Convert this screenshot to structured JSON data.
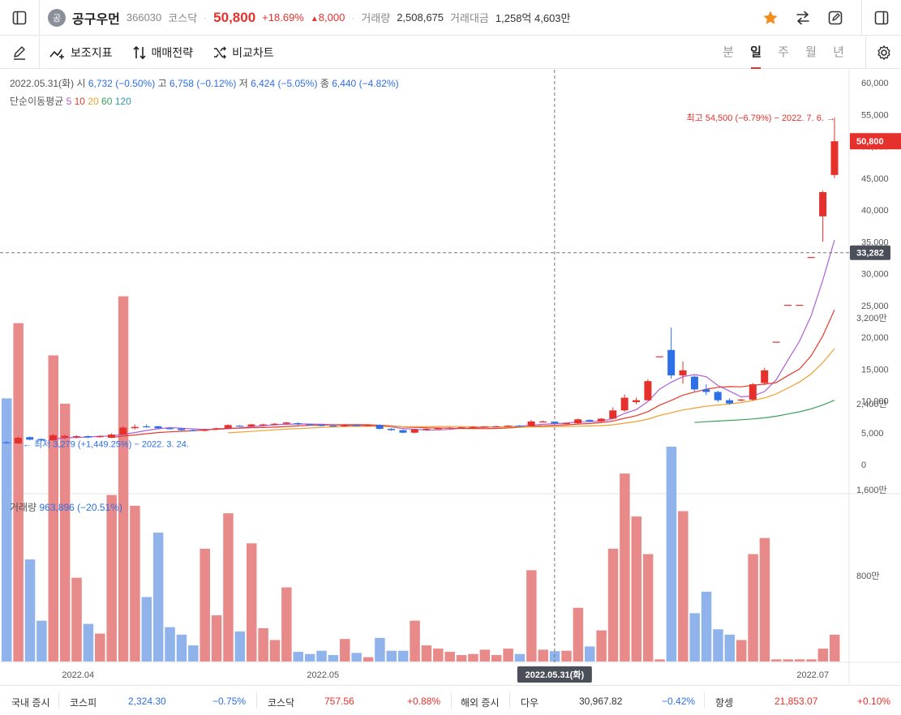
{
  "header": {
    "badge": "공",
    "name": "공구우먼",
    "code": "366030",
    "market": "코스닥",
    "price": "50,800",
    "change_pct": "+18.69%",
    "change_amt": "8,000",
    "volume_label": "거래량",
    "volume": "2,508,675",
    "amount_label": "거래대금",
    "amount": "1,258억 4,603만"
  },
  "toolbar": {
    "indicator_label": "보조지표",
    "strategy_label": "매매전략",
    "compare_label": "비교차트",
    "periods": [
      "분",
      "일",
      "주",
      "월",
      "년"
    ],
    "active_period": "일"
  },
  "ohlc_info": {
    "date": "2022.05.31(화)",
    "open_label": "시",
    "open": "6,732 (−0.50%)",
    "high_label": "고",
    "high": "6,758 (−0.12%)",
    "low_label": "저",
    "low": "6,424 (−5.05%)",
    "close_label": "종",
    "close": "6,440 (−4.82%)"
  },
  "ma_legend": {
    "label": "단순이동평균",
    "items": [
      {
        "name": "5",
        "color": "#b05fd6"
      },
      {
        "name": "10",
        "color": "#e63b2c"
      },
      {
        "name": "20",
        "color": "#f0a12c"
      },
      {
        "name": "60",
        "color": "#3aa05a"
      },
      {
        "name": "120",
        "color": "#2b9ab3"
      }
    ]
  },
  "volume_info": {
    "label": "거래량",
    "value": "963,896 (−20.51%)"
  },
  "footer": {
    "domestic_label": "국내 증시",
    "kospi_label": "코스피",
    "kospi": "2,324.30",
    "kospi_chg": "−0.75%",
    "kosdaq_label": "코스닥",
    "kosdaq": "757.56",
    "kosdaq_chg": "+0.88%",
    "overseas_label": "해외 증시",
    "dow_label": "다우",
    "dow": "30,967.82",
    "dow_chg": "−0.42%",
    "hs_label": "항셍",
    "hs": "21,853.07",
    "hs_chg": "+0.10%"
  },
  "colors": {
    "up": "#e6302c",
    "down": "#2d6fe6",
    "vol_up": "#e88a8a",
    "vol_down": "#8fb3ea",
    "star": "#f28c1c"
  },
  "chart_data": {
    "type": "candlestick",
    "price_axis": {
      "min": 0,
      "max": 60000,
      "ticks": [
        "60,000",
        "55,000",
        "50,000",
        "45,000",
        "40,000",
        "35,000",
        "30,000",
        "25,000",
        "20,000",
        "15,000",
        "10,000",
        "5,000",
        "0"
      ]
    },
    "volume_axis": {
      "max": 3600,
      "unit": "만",
      "ticks": [
        "3,200만",
        "2,400만",
        "1,600만",
        "800만"
      ]
    },
    "x_labels": [
      "2022.04",
      "2022.05",
      "2022.07"
    ],
    "crosshair": {
      "date": "2022.05.31(화)",
      "price": "33,282"
    },
    "current_price": "50,800",
    "annotation_high": "최고 54,500 (−6.79%) − 2022. 7. 6.",
    "annotation_low": "최저 3,279 (+1,449.25%) − 2022. 3. 24.",
    "candles": [
      {
        "date": "2022-03-24",
        "o": 3500,
        "h": 3650,
        "l": 3279,
        "c": 3400,
        "v": 2450
      },
      {
        "date": "2022-03-25",
        "o": 3300,
        "h": 4400,
        "l": 3250,
        "c": 4200,
        "v": 3150
      },
      {
        "date": "2022-03-28",
        "o": 4300,
        "h": 4400,
        "l": 3800,
        "c": 3900,
        "v": 950
      },
      {
        "date": "2022-03-29",
        "o": 4000,
        "h": 4100,
        "l": 3700,
        "c": 3800,
        "v": 380
      },
      {
        "date": "2022-03-30",
        "o": 3800,
        "h": 4800,
        "l": 3750,
        "c": 4600,
        "v": 2850
      },
      {
        "date": "2022-03-31",
        "o": 4200,
        "h": 4700,
        "l": 4000,
        "c": 4500,
        "v": 2400
      },
      {
        "date": "2022-04-01",
        "o": 4300,
        "h": 4600,
        "l": 4100,
        "c": 4450,
        "v": 780
      },
      {
        "date": "2022-04-04",
        "o": 4450,
        "h": 4550,
        "l": 4150,
        "c": 4250,
        "v": 350
      },
      {
        "date": "2022-04-05",
        "o": 4300,
        "h": 4550,
        "l": 4200,
        "c": 4450,
        "v": 260
      },
      {
        "date": "2022-04-06",
        "o": 4200,
        "h": 4900,
        "l": 4150,
        "c": 4700,
        "v": 1550
      },
      {
        "date": "2022-04-07",
        "o": 4700,
        "h": 6000,
        "l": 4650,
        "c": 5800,
        "v": 3400
      },
      {
        "date": "2022-04-08",
        "o": 5700,
        "h": 6300,
        "l": 5500,
        "c": 5900,
        "v": 1450
      },
      {
        "date": "2022-04-11",
        "o": 6000,
        "h": 6300,
        "l": 5800,
        "c": 5900,
        "v": 600
      },
      {
        "date": "2022-04-12",
        "o": 6000,
        "h": 6100,
        "l": 5600,
        "c": 5700,
        "v": 1200
      },
      {
        "date": "2022-04-13",
        "o": 5700,
        "h": 5800,
        "l": 5500,
        "c": 5650,
        "v": 320
      },
      {
        "date": "2022-04-14",
        "o": 5650,
        "h": 5700,
        "l": 5300,
        "c": 5400,
        "v": 250
      },
      {
        "date": "2022-04-15",
        "o": 5400,
        "h": 5500,
        "l": 5200,
        "c": 5300,
        "v": 150
      },
      {
        "date": "2022-04-18",
        "o": 5300,
        "h": 5600,
        "l": 5200,
        "c": 5500,
        "v": 1050
      },
      {
        "date": "2022-04-19",
        "o": 5500,
        "h": 5800,
        "l": 5400,
        "c": 5700,
        "v": 430
      },
      {
        "date": "2022-04-20",
        "o": 5700,
        "h": 6300,
        "l": 5600,
        "c": 6200,
        "v": 1380
      },
      {
        "date": "2022-04-21",
        "o": 6100,
        "h": 6200,
        "l": 5900,
        "c": 6000,
        "v": 280
      },
      {
        "date": "2022-04-22",
        "o": 6000,
        "h": 6400,
        "l": 5900,
        "c": 6300,
        "v": 1100
      },
      {
        "date": "2022-04-25",
        "o": 6200,
        "h": 6400,
        "l": 6000,
        "c": 6300,
        "v": 310
      },
      {
        "date": "2022-04-26",
        "o": 6300,
        "h": 6500,
        "l": 6100,
        "c": 6400,
        "v": 200
      },
      {
        "date": "2022-04-27",
        "o": 6400,
        "h": 6700,
        "l": 6300,
        "c": 6600,
        "v": 690
      },
      {
        "date": "2022-04-28",
        "o": 6500,
        "h": 6600,
        "l": 6200,
        "c": 6300,
        "v": 90
      },
      {
        "date": "2022-04-29",
        "o": 6300,
        "h": 6400,
        "l": 6100,
        "c": 6200,
        "v": 70
      },
      {
        "date": "2022-05-02",
        "o": 6200,
        "h": 6300,
        "l": 6000,
        "c": 6100,
        "v": 100
      },
      {
        "date": "2022-05-03",
        "o": 6100,
        "h": 6200,
        "l": 5900,
        "c": 6000,
        "v": 60
      },
      {
        "date": "2022-05-04",
        "o": 6000,
        "h": 6400,
        "l": 5900,
        "c": 6200,
        "v": 210
      },
      {
        "date": "2022-05-06",
        "o": 6200,
        "h": 6300,
        "l": 6000,
        "c": 6100,
        "v": 80
      },
      {
        "date": "2022-05-09",
        "o": 6100,
        "h": 6300,
        "l": 6000,
        "c": 6200,
        "v": 40
      },
      {
        "date": "2022-05-10",
        "o": 6200,
        "h": 6300,
        "l": 5500,
        "c": 5600,
        "v": 220
      },
      {
        "date": "2022-05-11",
        "o": 5600,
        "h": 5700,
        "l": 5300,
        "c": 5400,
        "v": 100
      },
      {
        "date": "2022-05-12",
        "o": 5400,
        "h": 5500,
        "l": 4900,
        "c": 5000,
        "v": 100
      },
      {
        "date": "2022-05-13",
        "o": 5000,
        "h": 5600,
        "l": 4900,
        "c": 5500,
        "v": 380
      },
      {
        "date": "2022-05-16",
        "o": 5500,
        "h": 5700,
        "l": 5300,
        "c": 5600,
        "v": 150
      },
      {
        "date": "2022-05-17",
        "o": 5600,
        "h": 5800,
        "l": 5500,
        "c": 5700,
        "v": 120
      },
      {
        "date": "2022-05-18",
        "o": 5700,
        "h": 5900,
        "l": 5600,
        "c": 5800,
        "v": 90
      },
      {
        "date": "2022-05-19",
        "o": 5800,
        "h": 5900,
        "l": 5700,
        "c": 5850,
        "v": 60
      },
      {
        "date": "2022-05-20",
        "o": 5850,
        "h": 6000,
        "l": 5800,
        "c": 5900,
        "v": 70
      },
      {
        "date": "2022-05-23",
        "o": 5900,
        "h": 6000,
        "l": 5800,
        "c": 5950,
        "v": 110
      },
      {
        "date": "2022-05-24",
        "o": 5950,
        "h": 6100,
        "l": 5900,
        "c": 6000,
        "v": 60
      },
      {
        "date": "2022-05-25",
        "o": 6000,
        "h": 6200,
        "l": 5950,
        "c": 6100,
        "v": 120
      },
      {
        "date": "2022-05-26",
        "o": 6100,
        "h": 6200,
        "l": 6000,
        "c": 6050,
        "v": 70
      },
      {
        "date": "2022-05-27",
        "o": 6050,
        "h": 7000,
        "l": 6000,
        "c": 6765,
        "v": 850
      },
      {
        "date": "2022-05-30",
        "o": 6766,
        "h": 6900,
        "l": 6700,
        "c": 6766,
        "v": 110
      },
      {
        "date": "2022-05-31",
        "o": 6732,
        "h": 6758,
        "l": 6424,
        "c": 6440,
        "v": 96
      },
      {
        "date": "2022-06-02",
        "o": 6440,
        "h": 6600,
        "l": 6400,
        "c": 6500,
        "v": 100
      },
      {
        "date": "2022-06-03",
        "o": 6500,
        "h": 7200,
        "l": 6400,
        "c": 7100,
        "v": 500
      },
      {
        "date": "2022-06-07",
        "o": 7000,
        "h": 7100,
        "l": 6700,
        "c": 6800,
        "v": 140
      },
      {
        "date": "2022-06-08",
        "o": 6800,
        "h": 7300,
        "l": 6700,
        "c": 7200,
        "v": 290
      },
      {
        "date": "2022-06-09",
        "o": 7200,
        "h": 9000,
        "l": 7100,
        "c": 8500,
        "v": 1050
      },
      {
        "date": "2022-06-10",
        "o": 8500,
        "h": 11000,
        "l": 8300,
        "c": 10500,
        "v": 1750
      },
      {
        "date": "2022-06-13",
        "o": 9800,
        "h": 10500,
        "l": 9500,
        "c": 10100,
        "v": 1350
      },
      {
        "date": "2022-06-14",
        "o": 10100,
        "h": 13400,
        "l": 10000,
        "c": 13100,
        "v": 1000
      },
      {
        "date": "2022-06-15",
        "o": 17000,
        "h": 17000,
        "l": 17000,
        "c": 17000,
        "v": 20
      },
      {
        "date": "2022-06-16",
        "o": 18000,
        "h": 21500,
        "l": 13500,
        "c": 14000,
        "v": 2000
      },
      {
        "date": "2022-06-17",
        "o": 14000,
        "h": 16200,
        "l": 12700,
        "c": 14800,
        "v": 1400
      },
      {
        "date": "2022-06-20",
        "o": 13800,
        "h": 14000,
        "l": 11500,
        "c": 11800,
        "v": 450
      },
      {
        "date": "2022-06-21",
        "o": 11800,
        "h": 12600,
        "l": 10900,
        "c": 11400,
        "v": 650
      },
      {
        "date": "2022-06-22",
        "o": 11400,
        "h": 11600,
        "l": 9800,
        "c": 10100,
        "v": 300
      },
      {
        "date": "2022-06-23",
        "o": 10100,
        "h": 10400,
        "l": 9400,
        "c": 9600,
        "v": 250
      },
      {
        "date": "2022-06-24",
        "o": 10100,
        "h": 10300,
        "l": 9900,
        "c": 10200,
        "v": 200
      },
      {
        "date": "2022-06-27",
        "o": 10200,
        "h": 12800,
        "l": 10000,
        "c": 12600,
        "v": 1000
      },
      {
        "date": "2022-06-28",
        "o": 12800,
        "h": 15200,
        "l": 12500,
        "c": 14800,
        "v": 1150
      },
      {
        "date": "2022-06-29",
        "o": 19300,
        "h": 19300,
        "l": 19300,
        "c": 19300,
        "v": 20
      },
      {
        "date": "2022-06-30",
        "o": 25100,
        "h": 25100,
        "l": 25100,
        "c": 25100,
        "v": 20
      },
      {
        "date": "2022-07-01",
        "o": 25100,
        "h": 25100,
        "l": 25100,
        "c": 25100,
        "v": 20
      },
      {
        "date": "2022-07-04",
        "o": 32600,
        "h": 32600,
        "l": 32600,
        "c": 32600,
        "v": 20
      },
      {
        "date": "2022-07-05",
        "o": 39000,
        "h": 43000,
        "l": 35000,
        "c": 42800,
        "v": 120
      },
      {
        "date": "2022-07-06",
        "o": 45500,
        "h": 54500,
        "l": 45000,
        "c": 50800,
        "v": 250
      }
    ]
  }
}
